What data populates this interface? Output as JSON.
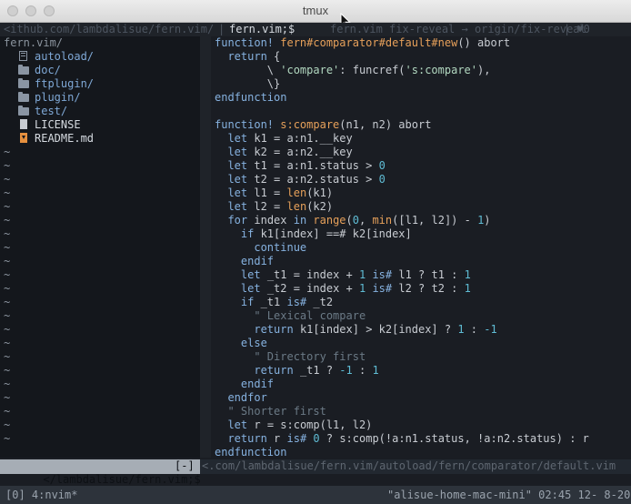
{
  "window": {
    "title": "tmux"
  },
  "tabline": {
    "left": "<ithub.com/lambdalisue/fern.vim/",
    "sep": "|",
    "active": "fern.vim;$",
    "rest": "fern.vim fix-reveal → origin/fix-reveal",
    "right": "| ♥0"
  },
  "tree": {
    "root": "fern.vim/",
    "items": [
      {
        "label": "autoload/",
        "icon": "book-icon",
        "kind": "dir"
      },
      {
        "label": "doc/",
        "icon": "folder-icon",
        "kind": "dir"
      },
      {
        "label": "ftplugin/",
        "icon": "folder-icon",
        "kind": "dir"
      },
      {
        "label": "plugin/",
        "icon": "folder-icon",
        "kind": "dir"
      },
      {
        "label": "test/",
        "icon": "folder-icon",
        "kind": "dir"
      },
      {
        "label": "LICENSE",
        "icon": "license-file-icon",
        "kind": "file"
      },
      {
        "label": "README.md",
        "icon": "readme-file-icon",
        "kind": "file"
      }
    ],
    "filler": "~"
  },
  "editor": {
    "lines": [
      [
        [
          "kw",
          "function! "
        ],
        [
          "fn",
          "fern#comparator#default#new"
        ],
        [
          "tx",
          "() abort"
        ]
      ],
      [
        [
          "tx",
          "  "
        ],
        [
          "kw",
          "return"
        ],
        [
          "tx",
          " {"
        ]
      ],
      [
        [
          "tx",
          "        \\ "
        ],
        [
          "str",
          "'compare'"
        ],
        [
          "tx",
          ": funcref("
        ],
        [
          "str",
          "'s:compare'"
        ],
        [
          "tx",
          "),"
        ]
      ],
      [
        [
          "tx",
          "        \\}"
        ]
      ],
      [
        [
          "kw",
          "endfunction"
        ]
      ],
      [],
      [
        [
          "kw",
          "function! "
        ],
        [
          "fn",
          "s:compare"
        ],
        [
          "tx",
          "(n1, n2) abort"
        ]
      ],
      [
        [
          "tx",
          "  "
        ],
        [
          "kw",
          "let"
        ],
        [
          "tx",
          " k1 = a:n1.__key"
        ]
      ],
      [
        [
          "tx",
          "  "
        ],
        [
          "kw",
          "let"
        ],
        [
          "tx",
          " k2 = a:n2.__key"
        ]
      ],
      [
        [
          "tx",
          "  "
        ],
        [
          "kw",
          "let"
        ],
        [
          "tx",
          " t1 = a:n1.status > "
        ],
        [
          "num",
          "0"
        ]
      ],
      [
        [
          "tx",
          "  "
        ],
        [
          "kw",
          "let"
        ],
        [
          "tx",
          " t2 = a:n2.status > "
        ],
        [
          "num",
          "0"
        ]
      ],
      [
        [
          "tx",
          "  "
        ],
        [
          "kw",
          "let"
        ],
        [
          "tx",
          " l1 = "
        ],
        [
          "fn",
          "len"
        ],
        [
          "tx",
          "(k1)"
        ]
      ],
      [
        [
          "tx",
          "  "
        ],
        [
          "kw",
          "let"
        ],
        [
          "tx",
          " l2 = "
        ],
        [
          "fn",
          "len"
        ],
        [
          "tx",
          "(k2)"
        ]
      ],
      [
        [
          "tx",
          "  "
        ],
        [
          "kw",
          "for"
        ],
        [
          "tx",
          " index "
        ],
        [
          "kw",
          "in"
        ],
        [
          "tx",
          " "
        ],
        [
          "fn",
          "range"
        ],
        [
          "tx",
          "("
        ],
        [
          "num",
          "0"
        ],
        [
          "tx",
          ", "
        ],
        [
          "fn",
          "min"
        ],
        [
          "tx",
          "([l1, l2]) - "
        ],
        [
          "num",
          "1"
        ],
        [
          "tx",
          ")"
        ]
      ],
      [
        [
          "tx",
          "    "
        ],
        [
          "kw",
          "if"
        ],
        [
          "tx",
          " k1[index] ==# k2[index]"
        ]
      ],
      [
        [
          "tx",
          "      "
        ],
        [
          "kw",
          "continue"
        ]
      ],
      [
        [
          "tx",
          "    "
        ],
        [
          "kw",
          "endif"
        ]
      ],
      [
        [
          "tx",
          "    "
        ],
        [
          "kw",
          "let"
        ],
        [
          "tx",
          " _t1 = index + "
        ],
        [
          "num",
          "1"
        ],
        [
          "tx",
          " "
        ],
        [
          "kw",
          "is#"
        ],
        [
          "tx",
          " l1 ? t1 : "
        ],
        [
          "num",
          "1"
        ]
      ],
      [
        [
          "tx",
          "    "
        ],
        [
          "kw",
          "let"
        ],
        [
          "tx",
          " _t2 = index + "
        ],
        [
          "num",
          "1"
        ],
        [
          "tx",
          " "
        ],
        [
          "kw",
          "is#"
        ],
        [
          "tx",
          " l2 ? t2 : "
        ],
        [
          "num",
          "1"
        ]
      ],
      [
        [
          "tx",
          "    "
        ],
        [
          "kw",
          "if"
        ],
        [
          "tx",
          " _t1 "
        ],
        [
          "kw",
          "is#"
        ],
        [
          "tx",
          " _t2"
        ]
      ],
      [
        [
          "tx",
          "      "
        ],
        [
          "cmt",
          "\" Lexical compare"
        ]
      ],
      [
        [
          "tx",
          "      "
        ],
        [
          "kw",
          "return"
        ],
        [
          "tx",
          " k1[index] > k2[index] ? "
        ],
        [
          "num",
          "1"
        ],
        [
          "tx",
          " : "
        ],
        [
          "num",
          "-1"
        ]
      ],
      [
        [
          "tx",
          "    "
        ],
        [
          "kw",
          "else"
        ]
      ],
      [
        [
          "tx",
          "      "
        ],
        [
          "cmt",
          "\" Directory first"
        ]
      ],
      [
        [
          "tx",
          "      "
        ],
        [
          "kw",
          "return"
        ],
        [
          "tx",
          " _t1 ? "
        ],
        [
          "num",
          "-1"
        ],
        [
          "tx",
          " : "
        ],
        [
          "num",
          "1"
        ]
      ],
      [
        [
          "tx",
          "    "
        ],
        [
          "kw",
          "endif"
        ]
      ],
      [
        [
          "tx",
          "  "
        ],
        [
          "kw",
          "endfor"
        ]
      ],
      [
        [
          "tx",
          "  "
        ],
        [
          "cmt",
          "\" Shorter first"
        ]
      ],
      [
        [
          "tx",
          "  "
        ],
        [
          "kw",
          "let"
        ],
        [
          "tx",
          " r = s:comp(l1, l2)"
        ]
      ],
      [
        [
          "tx",
          "  "
        ],
        [
          "kw",
          "return"
        ],
        [
          "tx",
          " r "
        ],
        [
          "kw",
          "is#"
        ],
        [
          "tx",
          " "
        ],
        [
          "num",
          "0"
        ],
        [
          "tx",
          " ? s:comp(!a:n1.status, !a:n2.status) : r"
        ]
      ],
      [
        [
          "kw",
          "endfunction"
        ]
      ]
    ]
  },
  "statusline": {
    "left": "</lambdalisue/fern.vim;$",
    "mode": "[-]",
    "right": "<.com/lambdalisue/fern.vim/autoload/fern/comparator/default.vim"
  },
  "tmux": {
    "left": "[0] 4:nvim*",
    "right": "\"alisue-home-mac-mini\" 02:45 12- 8-20"
  }
}
